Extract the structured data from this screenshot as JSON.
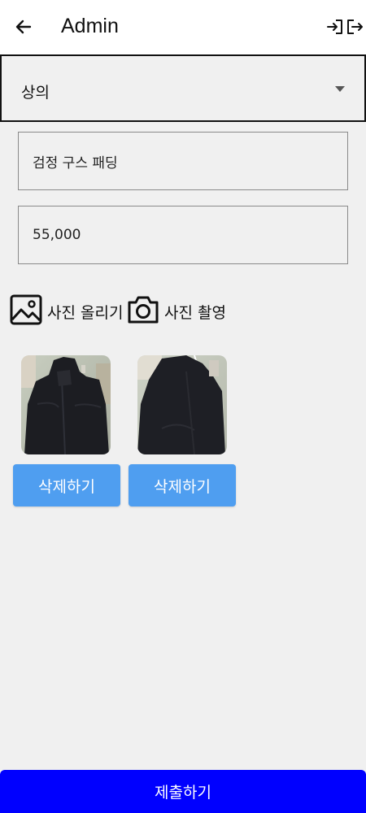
{
  "appbar": {
    "title": "Admin",
    "back_icon": "arrow-back-icon",
    "login_icon": "login-icon",
    "logout_icon": "logout-icon"
  },
  "category_select": {
    "selected": "상의",
    "icon": "dropdown-arrow-icon"
  },
  "form": {
    "name_value": "검정 구스 패딩",
    "price_value": "55,000"
  },
  "photo_actions": {
    "upload_label": "사진 올리기",
    "upload_icon": "image-icon",
    "camera_label": "사진 촬영",
    "camera_icon": "camera-icon"
  },
  "photos": [
    {
      "delete_label": "삭제하기"
    },
    {
      "delete_label": "삭제하기"
    }
  ],
  "submit_label": "제출하기",
  "colors": {
    "background": "#f0f0f0",
    "delete_button": "#4f9ef0",
    "submit_button": "#0000ff"
  }
}
